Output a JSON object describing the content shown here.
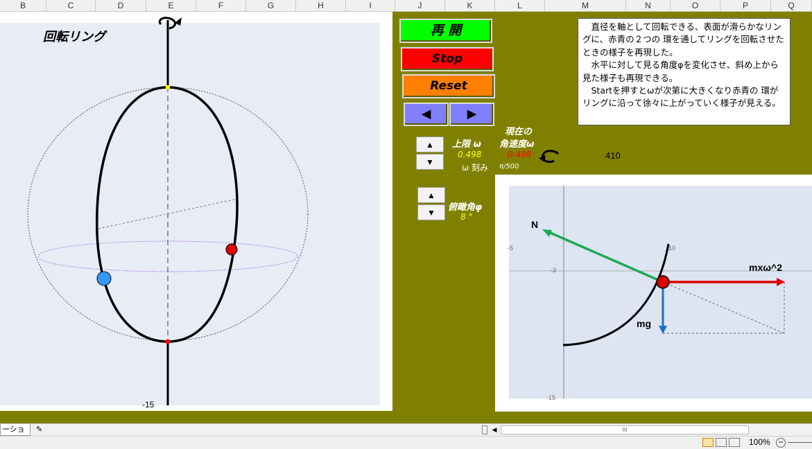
{
  "columns": [
    "B",
    "C",
    "D",
    "E",
    "F",
    "G",
    "H",
    "I",
    "J",
    "K",
    "L",
    "M",
    "N",
    "O",
    "P",
    "Q"
  ],
  "ring_chart": {
    "title": "回転リング",
    "bottom_label": "-15"
  },
  "buttons": {
    "restart": "再 開",
    "stop": "Stop",
    "reset": "Reset",
    "prev": "◀",
    "next": "▶"
  },
  "controls": {
    "upper_limit_label": "上限 ω",
    "upper_limit_value": "0.498",
    "current_label_1": "現在の",
    "current_label_2": "角速度ω",
    "current_value": "0.498",
    "step_label": "ω 刻み",
    "step_value": "π/500",
    "counter": "410",
    "angle_label": "俯瞰角φ",
    "angle_value": "8 °"
  },
  "description": "　直径を軸として回転できる、表面が滑らかなリングに、赤青の２つの 環を通してリングを回転させたときの様子を再現した。\n　水平に対して見る角度φを変化させ、斜め上から見た様子も再現できる。\n　Startを押すとωが次第に大きくなり赤青の 環がリングに沿って徐々に上がっていく様子が見える。",
  "force_chart": {
    "label_N": "N",
    "label_mg": "mg",
    "label_mxw": "mxω^2",
    "tick_x_left": "-5",
    "tick_x_right": "10",
    "tick_y_top": "-3",
    "tick_y_bottom": "-15"
  },
  "status": {
    "sheet_tab": "ーション",
    "zoom": "100%",
    "scroll_glyph": "III"
  },
  "colors": {
    "background": "#808000",
    "restart": "#00ff00",
    "stop": "#ff0000",
    "reset": "#ff8000",
    "arrows": "#8080ff",
    "value_yellow": "#ffff00",
    "value_red": "#ff0000"
  }
}
